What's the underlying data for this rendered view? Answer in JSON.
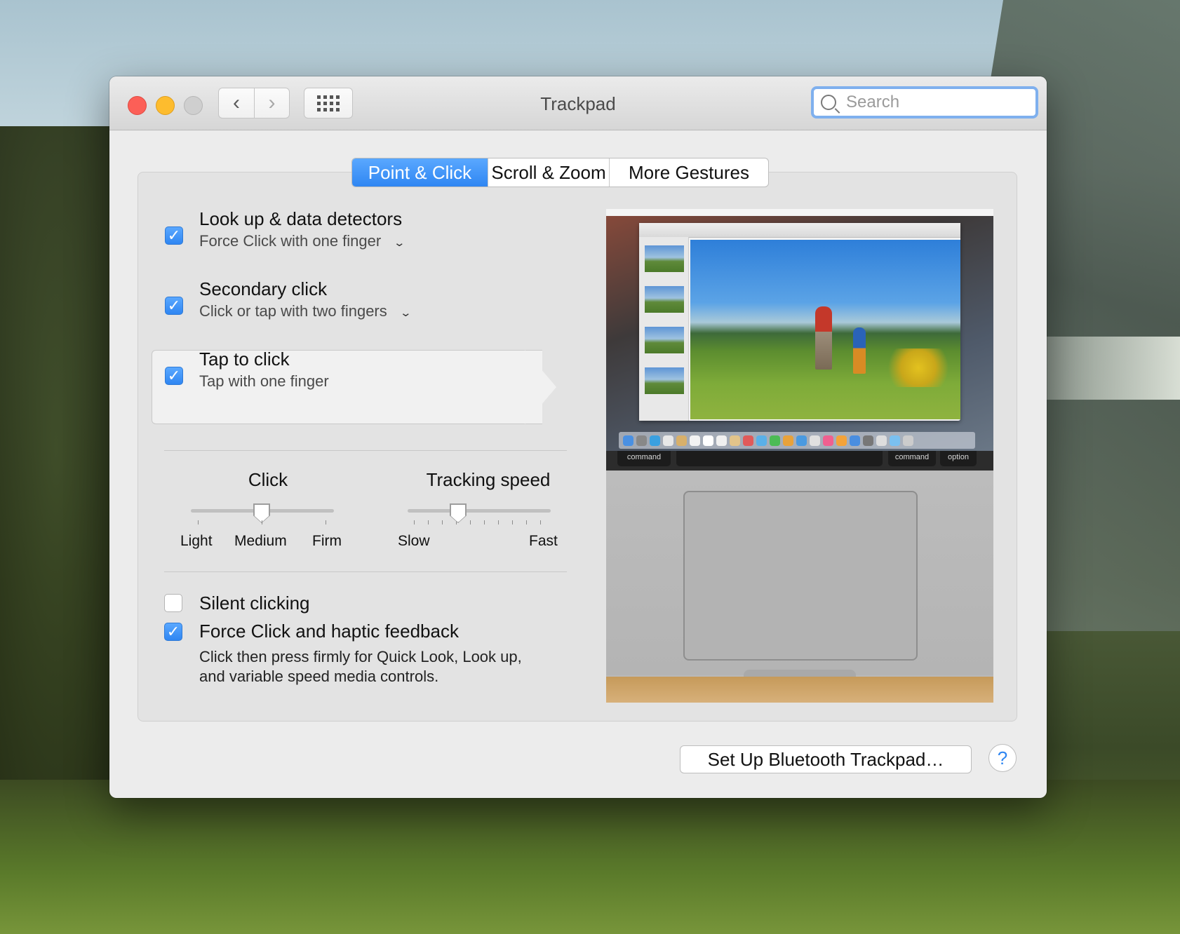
{
  "window": {
    "title": "Trackpad"
  },
  "search": {
    "placeholder": "Search"
  },
  "tabs": [
    {
      "label": "Point & Click",
      "active": true
    },
    {
      "label": "Scroll & Zoom",
      "active": false
    },
    {
      "label": "More Gestures",
      "active": false
    }
  ],
  "options": {
    "lookup": {
      "title": "Look up & data detectors",
      "subtitle": "Force Click with one finger",
      "checked": true
    },
    "secondary": {
      "title": "Secondary click",
      "subtitle": "Click or tap with two fingers",
      "checked": true
    },
    "tap": {
      "title": "Tap to click",
      "subtitle": "Tap with one finger",
      "checked": true
    },
    "silent": {
      "title": "Silent clicking",
      "checked": false
    },
    "force": {
      "title": "Force Click and haptic feedback",
      "checked": true,
      "desc_line1": "Click then press firmly for Quick Look, Look up,",
      "desc_line2": "and variable speed media controls."
    }
  },
  "click_slider": {
    "label": "Click",
    "ticks": [
      "Light",
      "Medium",
      "Firm"
    ],
    "value": "Medium"
  },
  "tracking_slider": {
    "label": "Tracking speed",
    "min_label": "Slow",
    "max_label": "Fast",
    "tick_count": 10,
    "value_index": 3
  },
  "preview": {
    "key_left": "command",
    "key_right1": "command",
    "key_right2": "option"
  },
  "footer": {
    "bluetooth_button": "Set Up Bluetooth Trackpad…",
    "help_label": "?"
  },
  "colors": {
    "accent": "#3b8ff5",
    "close": "#fc5f57",
    "minimize": "#fdbc2e"
  }
}
